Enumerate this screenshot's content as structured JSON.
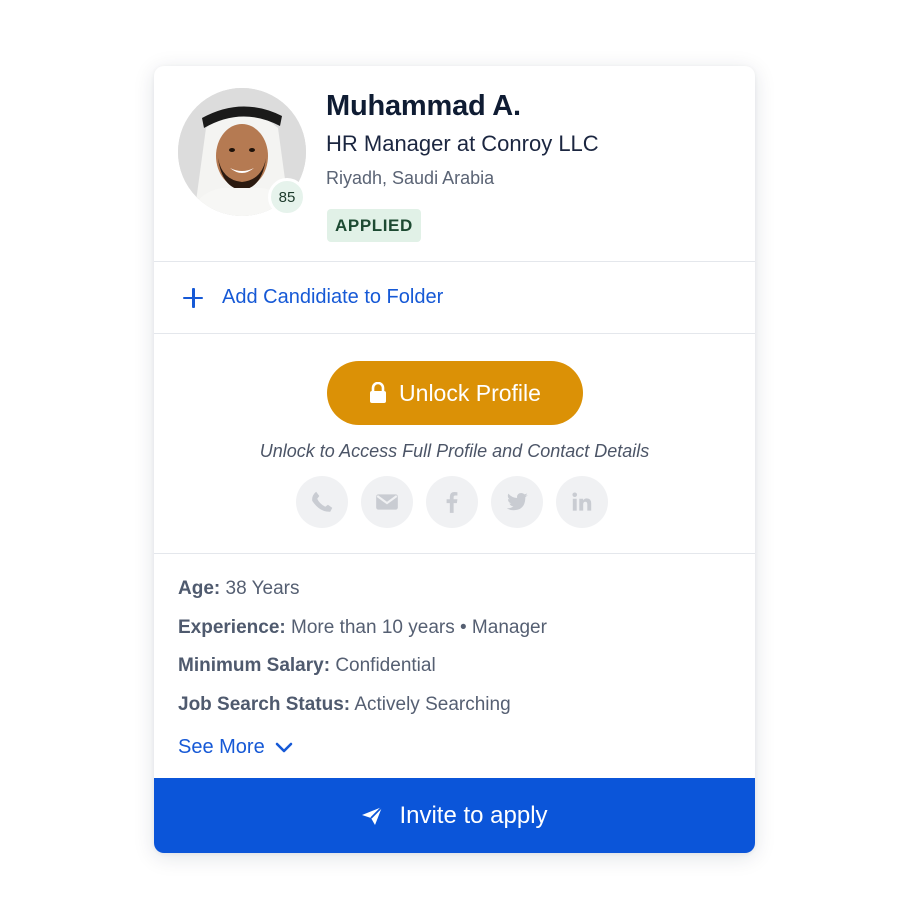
{
  "candidate": {
    "name": "Muhammad A.",
    "title": "HR Manager at Conroy LLC",
    "location": "Riyadh, Saudi Arabia",
    "score": "85",
    "status": "APPLIED"
  },
  "actions": {
    "add_folder_label": "Add Candidiate to Folder",
    "unlock_label": "Unlock Profile",
    "unlock_hint": "Unlock to Access Full Profile and Contact Details",
    "see_more_label": "See More",
    "invite_label": "Invite to apply"
  },
  "contact_icons": [
    "phone-icon",
    "email-icon",
    "facebook-icon",
    "twitter-icon",
    "linkedin-icon"
  ],
  "details": [
    {
      "label": "Age:",
      "value": "38 Years"
    },
    {
      "label": "Experience:",
      "value": "More than 10 years • Manager"
    },
    {
      "label": "Minimum Salary:",
      "value": "Confidential"
    },
    {
      "label": "Job Search Status:",
      "value": "Actively Searching"
    }
  ],
  "colors": {
    "accent_blue": "#0b55d9",
    "unlock_orange": "#db9106",
    "status_green_bg": "#e1f1e7"
  }
}
